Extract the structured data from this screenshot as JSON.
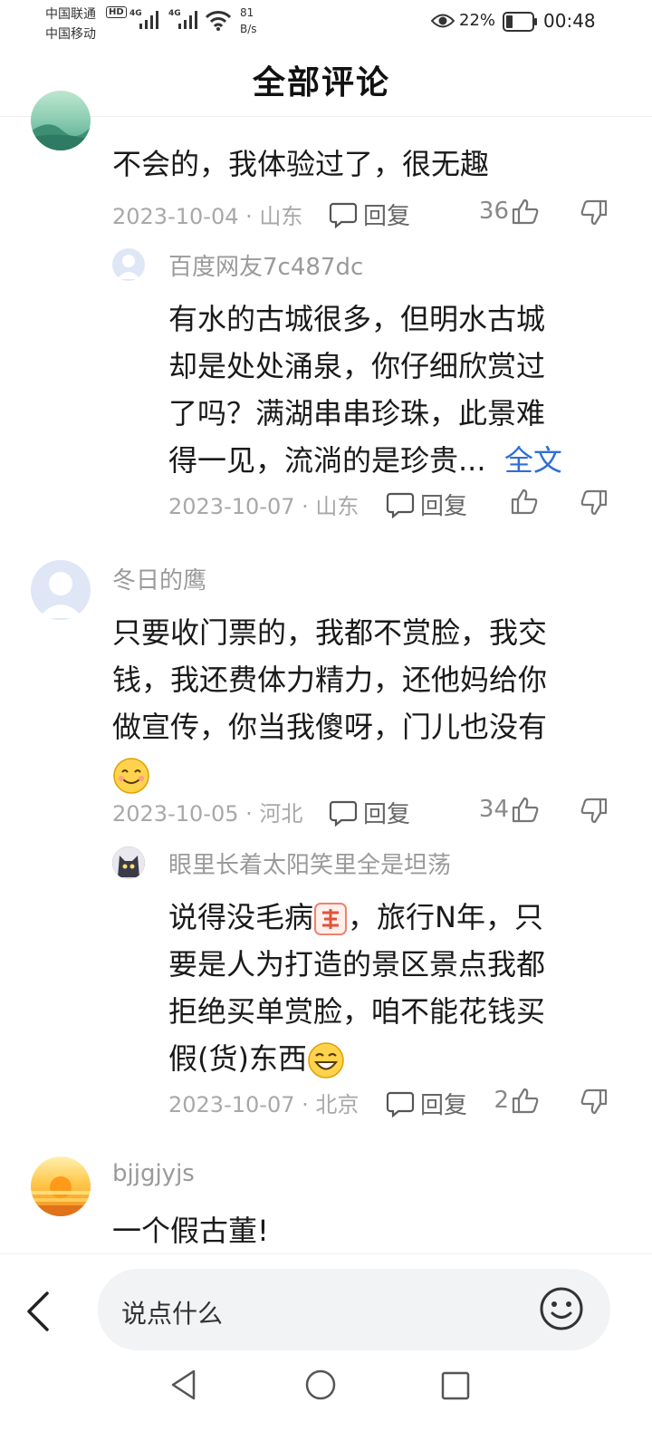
{
  "status_bar": {
    "carrier1": "中国联通",
    "carrier2": "中国移动",
    "hd": "HD",
    "net1": "4G",
    "net2": "4G",
    "speed_value": "81",
    "speed_unit": "B/s",
    "battery": "22%",
    "time": "00:48"
  },
  "header": {
    "title": "全部评论"
  },
  "comments": [
    {
      "content": "不会的，我体验过了，很无趣",
      "meta": "2023-10-04 · 山东",
      "reply_label": "回复",
      "likes": "36",
      "replies": [
        {
          "username": "百度网友7c487dc",
          "content_lines": [
            "有水的古城很多，但明水古城",
            "却是处处涌泉，你仔细欣赏过",
            "了吗？满湖串串珍珠，此景难"
          ],
          "content_last": "得一见，流淌的是珍贵...",
          "full_text_label": "全文",
          "meta": "2023-10-07 · 山东",
          "reply_label": "回复"
        }
      ]
    },
    {
      "username": "冬日的鹰",
      "content_lines": [
        "只要收门票的，我都不赏脸，我交",
        "钱，我还费体力精力，还他妈给你",
        "做宣传，你当我傻呀，门儿也没有"
      ],
      "meta": "2023-10-05 · 河北",
      "reply_label": "回复",
      "likes": "34",
      "replies": [
        {
          "username": "眼里长着太阳笑里全是坦荡",
          "content_l1a": "说得没毛病",
          "content_l1b": "，旅行N年，只",
          "content_lines": [
            "要是人为打造的景区景点我都",
            "拒绝买单赏脸，咱不能花钱买"
          ],
          "content_last": "假(货)东西",
          "meta": "2023-10-07 · 北京",
          "reply_label": "回复",
          "likes": "2"
        }
      ]
    },
    {
      "username": "bjjgjyjs",
      "content": "一个假古董!"
    }
  ],
  "bottom": {
    "input_placeholder": "说点什么"
  },
  "colors": {
    "link": "#2f6fd6",
    "meta": "#a8a8a8",
    "username": "#9a9a9a",
    "input_bg": "#f2f3f5"
  },
  "icons": [
    "eye-icon",
    "battery-icon",
    "reply-icon",
    "thumb-up-icon",
    "thumb-down-icon",
    "back-arrow-icon",
    "emoji-icon",
    "nav-back-icon",
    "nav-home-icon",
    "nav-recent-icon"
  ]
}
